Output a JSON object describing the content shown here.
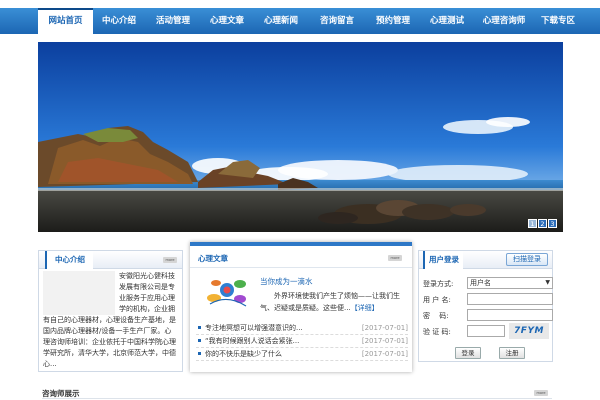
{
  "nav": {
    "items": [
      "网站首页",
      "中心介绍",
      "活动管理",
      "心理文章",
      "心理新闻",
      "咨询留言",
      "预约管理",
      "心理测试",
      "心理咨询师",
      "下载专区"
    ],
    "active_index": 0
  },
  "banner": {
    "pager": [
      "1",
      "2",
      "3"
    ],
    "active_page": 0
  },
  "intro": {
    "title": "中心介绍",
    "more": "more",
    "text": "安徽阳光心健科技发展有限公司是专业服务于应用心理学的机构，企业拥有自己的心理器材，心理设备生产基地，是国内品牌心理器材/设备一手生产厂家。心理咨询师培训：企业依托于中国科学院心理学研究所，清华大学，北京师范大学，中德心..."
  },
  "articles": {
    "title": "心理文章",
    "more": "more",
    "featured": {
      "title": "当你成为一滴水",
      "desc": "外界环境使我们产生了烦恼——让我们生气、迟疑或是质疑。这些便...",
      "detail": "【详细】"
    },
    "list": [
      {
        "title": "专注地冥想可以增强潜意识的...",
        "date": "[2017-07-01]"
      },
      {
        "title": "“我有时候跟别人说话会紧张...",
        "date": "[2017-07-01]"
      },
      {
        "title": "你的不快乐是缺少了什么",
        "date": "[2017-07-01]"
      }
    ]
  },
  "login": {
    "title": "用户登录",
    "scan_button": "扫描登录",
    "method_label": "登录方式:",
    "method_value": "用户名",
    "username_label": "用 户 名:",
    "password_label": "密　 码:",
    "captcha_label": "验 证 码:",
    "captcha_text": "7FYM",
    "login_button": "登录",
    "register_button": "注册"
  },
  "counselors": {
    "title": "咨询师展示",
    "more": "more"
  },
  "colors": {
    "nav": "#1c66b3",
    "accent": "#2e78c7",
    "link": "#1c66b3"
  }
}
